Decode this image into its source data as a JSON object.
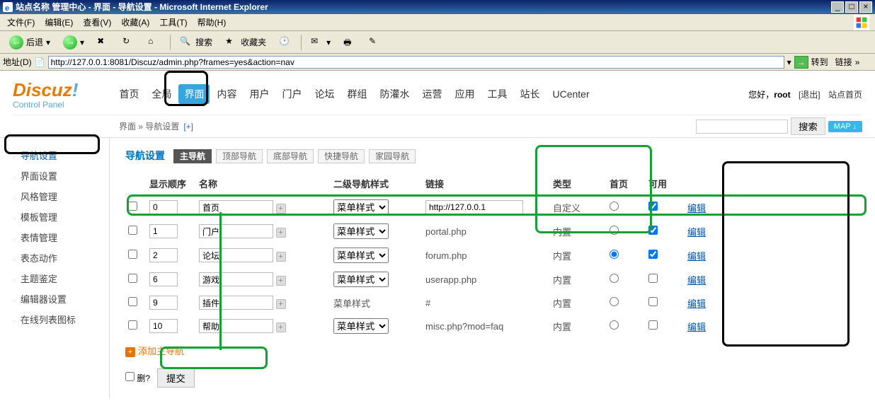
{
  "window": {
    "title": "站点名称 管理中心 - 界面 - 导航设置 - Microsoft Internet Explorer"
  },
  "menubar": {
    "file": "文件(F)",
    "edit": "编辑(E)",
    "view": "查看(V)",
    "fav": "收藏(A)",
    "tools": "工具(T)",
    "help": "帮助(H)"
  },
  "toolbar": {
    "back": "后退",
    "search": "搜索",
    "favorites": "收藏夹"
  },
  "addressbar": {
    "label": "地址(D)",
    "url": "http://127.0.0.1:8081/Discuz/admin.php?frames=yes&action=nav",
    "go": "转到",
    "links": "链接"
  },
  "logo": {
    "text": "Discuz",
    "sub": "Control Panel"
  },
  "main_nav": {
    "items": [
      "首页",
      "全局",
      "界面",
      "内容",
      "用户",
      "门户",
      "论坛",
      "群组",
      "防灌水",
      "运营",
      "应用",
      "工具",
      "站长",
      "UCenter"
    ],
    "active_index": 2
  },
  "user_info": {
    "greeting": "您好，",
    "user": "root",
    "logout": "[退出]",
    "home_link": "站点首页"
  },
  "breadcrumb": {
    "path": "界面 » 导航设置",
    "plus": "[+]"
  },
  "search": {
    "button": "搜索",
    "map": "MAP ↓"
  },
  "sidebar": {
    "items": [
      {
        "label": "导航设置",
        "active": true
      },
      {
        "label": "界面设置",
        "active": false
      },
      {
        "label": "风格管理",
        "active": false
      },
      {
        "label": "模板管理",
        "active": false
      },
      {
        "label": "表情管理",
        "active": false
      },
      {
        "label": "表态动作",
        "active": false
      },
      {
        "label": "主题鉴定",
        "active": false
      },
      {
        "label": "编辑器设置",
        "active": false
      },
      {
        "label": "在线列表图标",
        "active": false
      }
    ]
  },
  "page_title": "导航设置",
  "tabs": [
    "主导航",
    "顶部导航",
    "底部导航",
    "快捷导航",
    "家园导航"
  ],
  "active_tab": 0,
  "table": {
    "headers": {
      "chk": "",
      "order": "显示顺序",
      "name": "名称",
      "sub": "二级导航样式",
      "link": "链接",
      "type": "类型",
      "home": "首页",
      "enabled": "可用",
      "op": ""
    },
    "style_option": "菜单样式",
    "edit_label": "编辑",
    "rows": [
      {
        "order": "0",
        "name": "首页",
        "style_type": "select",
        "link": "http://127.0.0.1",
        "link_editable": true,
        "type": "自定义",
        "home": false,
        "enabled": true
      },
      {
        "order": "1",
        "name": "门户",
        "style_type": "select",
        "link": "portal.php",
        "link_editable": false,
        "type": "内置",
        "home": false,
        "enabled": true
      },
      {
        "order": "2",
        "name": "论坛",
        "style_type": "select",
        "link": "forum.php",
        "link_editable": false,
        "type": "内置",
        "home": true,
        "enabled": true
      },
      {
        "order": "6",
        "name": "游戏",
        "style_type": "select",
        "link": "userapp.php",
        "link_editable": false,
        "type": "内置",
        "home": false,
        "enabled": false
      },
      {
        "order": "9",
        "name": "插件",
        "style_type": "text",
        "link": "#",
        "link_editable": false,
        "type": "内置",
        "home": false,
        "enabled": false
      },
      {
        "order": "10",
        "name": "帮助",
        "style_type": "select",
        "link": "misc.php?mod=faq",
        "link_editable": false,
        "type": "内置",
        "home": false,
        "enabled": false
      }
    ]
  },
  "add_nav_label": "添加主导航",
  "delete_label": "删?",
  "submit_label": "提交"
}
